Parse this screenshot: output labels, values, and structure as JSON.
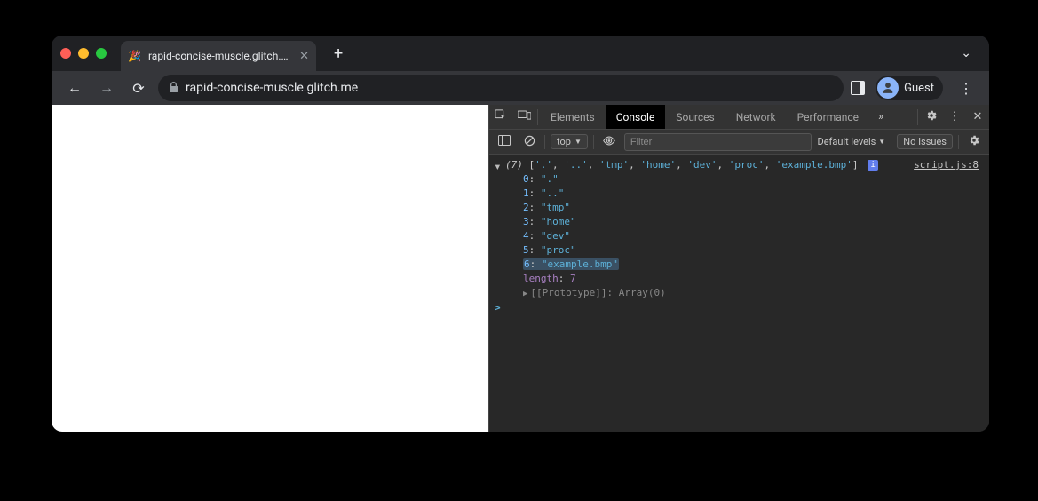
{
  "tab": {
    "favicon": "🎉",
    "title": "rapid-concise-muscle.glitch.me"
  },
  "address": {
    "url": "rapid-concise-muscle.glitch.me"
  },
  "profile": {
    "label": "Guest"
  },
  "devtools": {
    "tabs": [
      "Elements",
      "Console",
      "Sources",
      "Network",
      "Performance"
    ],
    "active_tab": "Console",
    "context": "top",
    "filter_placeholder": "Filter",
    "levels_label": "Default levels",
    "no_issues": "No Issues",
    "source_link": "script.js:8",
    "array_summary_len": "(7)",
    "array_summary_items": [
      "'.'",
      "'..'",
      "'tmp'",
      "'home'",
      "'dev'",
      "'proc'",
      "'example.bmp'"
    ],
    "expanded": [
      {
        "idx": "0",
        "val": "\".\""
      },
      {
        "idx": "1",
        "val": "\"..\""
      },
      {
        "idx": "2",
        "val": "\"tmp\""
      },
      {
        "idx": "3",
        "val": "\"home\""
      },
      {
        "idx": "4",
        "val": "\"dev\""
      },
      {
        "idx": "5",
        "val": "\"proc\""
      },
      {
        "idx": "6",
        "val": "\"example.bmp\"",
        "highlight": true
      }
    ],
    "length_key": "length",
    "length_val": "7",
    "proto_label": "[[Prototype]]",
    "proto_val": "Array(0)",
    "prompt": ">"
  }
}
